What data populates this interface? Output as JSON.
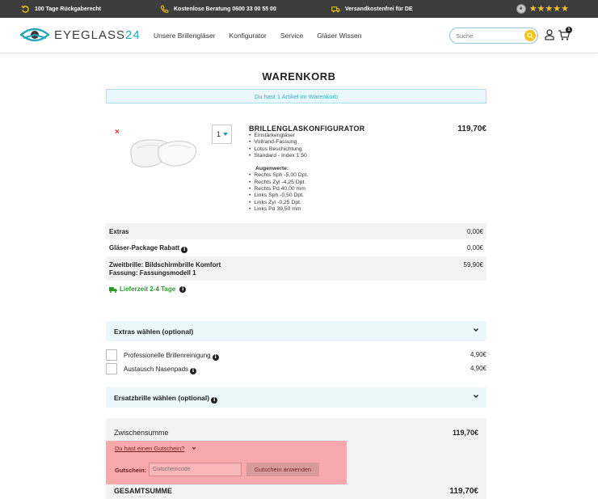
{
  "topbar": {
    "return_text": "100 Tage Rückgaberecht",
    "phone_text": "Kostenlose Beratung 0600 33 00 55 00",
    "shipping_text": "Versandkostenfrei für DE",
    "rating_stars": "★★★★★",
    "seal_text": "e"
  },
  "header": {
    "logo_main": "EYEGLASS",
    "logo_num": "24",
    "nav": [
      "Unsere Brillengläser",
      "Konfigurator",
      "Service",
      "Gläser Wissen"
    ],
    "search_placeholder": "Suche",
    "cart_count": "1"
  },
  "page": {
    "title": "WARENKORB",
    "notice": "Du hast 1 Artikel im Warenkorb"
  },
  "product": {
    "remove": "×",
    "qty": "1",
    "name": "BRILLENGLASKONFIGURATOR",
    "price": "119,70€",
    "features": [
      "Einstärkengläser",
      "Vollrand-Fassung",
      "Lotus Beschichtung",
      "Standard - Index 1.50"
    ],
    "augenwerte_label": "Augenwerte:",
    "augenwerte": [
      "Rechts Sph -5,00 Dpt.",
      "Rechts Zyl -4,25 Dpt.",
      "Rechts Pd 40,00 mm",
      "Links Sph -0,50 Dpt.",
      "Links Zyl -0,25 Dpt.",
      "Links Pd 39,50 mm"
    ]
  },
  "lines": {
    "extras_label": "Extras",
    "extras_value": "0,00€",
    "package_label": "Gläser-Package Rabatt",
    "package_value": "0,00€",
    "zweit_label_1": "Zweitbrille: Bildschirmbrille Komfort",
    "zweit_label_2": "Fassung: Fassungsmodell 1",
    "zweit_value": "59,90€"
  },
  "delivery": "Lieferzeit 2-4 Tage",
  "extras_section": {
    "title": "Extras wählen (optional)",
    "options": [
      {
        "label": "Professionelle Brillenreinigung",
        "price": "4,90€"
      },
      {
        "label": "Austausch Nasenpads",
        "price": "4,90€"
      }
    ]
  },
  "ersatz_section": {
    "title": "Ersatzbrille wählen (optional)"
  },
  "summary": {
    "subtotal_label": "Zwischensumme",
    "subtotal_value": "119,70€",
    "voucher_link": "Du hast einen Gutschein?",
    "voucher_label": "Gutschein:",
    "voucher_placeholder": "Gutscheincode",
    "voucher_button": "Gutschein anwenden",
    "total_label": "GESAMTSUMME",
    "total_value": "119,70€"
  },
  "colors": {
    "topbar": "#3d3d3d",
    "accent": "#26a7b8",
    "star": "#f6c23a",
    "highlight": "#f8a9ab",
    "delivery": "#2a9a2a"
  }
}
